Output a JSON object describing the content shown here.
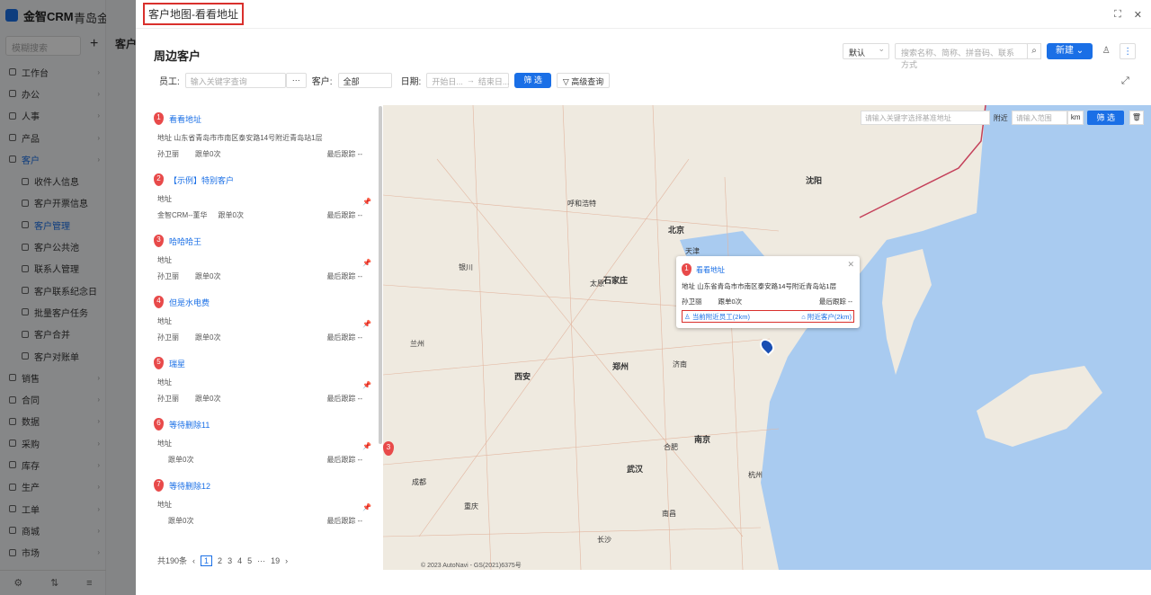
{
  "app": {
    "brand": "金智CRM",
    "company": "青岛金智公司",
    "sidebar_search": "模糊搜索",
    "bg_title": "客户管"
  },
  "sidebar": {
    "items": [
      {
        "label": "工作台",
        "level": 1
      },
      {
        "label": "办公",
        "level": 1
      },
      {
        "label": "人事",
        "level": 1
      },
      {
        "label": "产品",
        "level": 1
      },
      {
        "label": "客户",
        "level": 1,
        "active": true
      },
      {
        "label": "收件人信息",
        "level": 2
      },
      {
        "label": "客户开票信息",
        "level": 2
      },
      {
        "label": "客户管理",
        "level": 2,
        "active": true
      },
      {
        "label": "客户公共池",
        "level": 2
      },
      {
        "label": "联系人管理",
        "level": 2
      },
      {
        "label": "客户联系纪念日",
        "level": 2
      },
      {
        "label": "批量客户任务",
        "level": 2
      },
      {
        "label": "客户合并",
        "level": 2
      },
      {
        "label": "客户对账单",
        "level": 2
      },
      {
        "label": "销售",
        "level": 1
      },
      {
        "label": "合同",
        "level": 1
      },
      {
        "label": "数据",
        "level": 1
      },
      {
        "label": "采购",
        "level": 1
      },
      {
        "label": "库存",
        "level": 1
      },
      {
        "label": "生产",
        "level": 1
      },
      {
        "label": "工单",
        "level": 1
      },
      {
        "label": "商城",
        "level": 1
      },
      {
        "label": "市场",
        "level": 1
      }
    ]
  },
  "drawer": {
    "title": "客户地图-看看地址",
    "section": "周边客户"
  },
  "toolbar": {
    "view_select": "默认",
    "search_placeholder": "搜索名称、简称、拼音码、联系方式",
    "new_label": "新建"
  },
  "filter": {
    "employee_label": "员工:",
    "employee_placeholder": "输入关键字查询",
    "customer_label": "客户:",
    "customer_value": "全部",
    "date_label": "日期:",
    "date_start": "开始日...",
    "date_end": "结束日...",
    "filter_btn": "筛 选",
    "advanced_btn": "高级查询"
  },
  "list": {
    "items": [
      {
        "num": "1",
        "name": "看看地址",
        "addr": "地址  山东省青岛市市南区泰安路14号附近青岛站1层",
        "owner": "孙卫丽",
        "follow": "跟单0次",
        "last": "最后跟踪  --",
        "pinned": false
      },
      {
        "num": "2",
        "name": "【示例】特别客户",
        "addr": "地址",
        "owner": "金智CRM--董华",
        "follow": "跟单0次",
        "last": "最后跟踪  --",
        "pinned": true
      },
      {
        "num": "3",
        "name": "哈哈哈王",
        "addr": "地址",
        "owner": "孙卫丽",
        "follow": "跟单0次",
        "last": "最后跟踪  --",
        "pinned": true
      },
      {
        "num": "4",
        "name": "但是水电费",
        "addr": "地址",
        "owner": "孙卫丽",
        "follow": "跟单0次",
        "last": "最后跟踪  --",
        "pinned": true
      },
      {
        "num": "5",
        "name": "瑞星",
        "addr": "地址",
        "owner": "孙卫丽",
        "follow": "跟单0次",
        "last": "最后跟踪  --",
        "pinned": true
      },
      {
        "num": "6",
        "name": "等待删除11",
        "addr": "地址",
        "owner": "",
        "follow": "跟单0次",
        "last": "最后跟踪  --",
        "pinned": true
      },
      {
        "num": "7",
        "name": "等待删除12",
        "addr": "地址",
        "owner": "",
        "follow": "跟单0次",
        "last": "最后跟踪  --",
        "pinned": true
      }
    ]
  },
  "pager": {
    "total": "共190条",
    "pages": [
      "1",
      "2",
      "3",
      "4",
      "5",
      "···",
      "19"
    ]
  },
  "map": {
    "search_placeholder": "请输入关键字选择基准地址",
    "near_label": "附近",
    "range_placeholder": "请输入范围",
    "unit": "km",
    "filter_btn": "筛 选",
    "copyright": "© 2023 AutoNavi - GS(2021)6375号",
    "popup": {
      "num": "1",
      "name": "看看地址",
      "addr": "地址  山东省青岛市市南区泰安路14号附近青岛站1层",
      "owner": "孙卫丽",
      "follow": "跟单0次",
      "last": "最后跟踪  --",
      "link1": "当前附近员工(2km)",
      "link2": "附近客户(2km)"
    },
    "cities": [
      "呼和浩特",
      "北京",
      "天津",
      "沈阳",
      "石家庄",
      "太原",
      "银川",
      "兰州",
      "西安",
      "郑州",
      "济南",
      "合肥",
      "南京",
      "武汉",
      "杭州",
      "成都",
      "重庆",
      "长沙",
      "南昌"
    ],
    "cluster_count": "3"
  }
}
